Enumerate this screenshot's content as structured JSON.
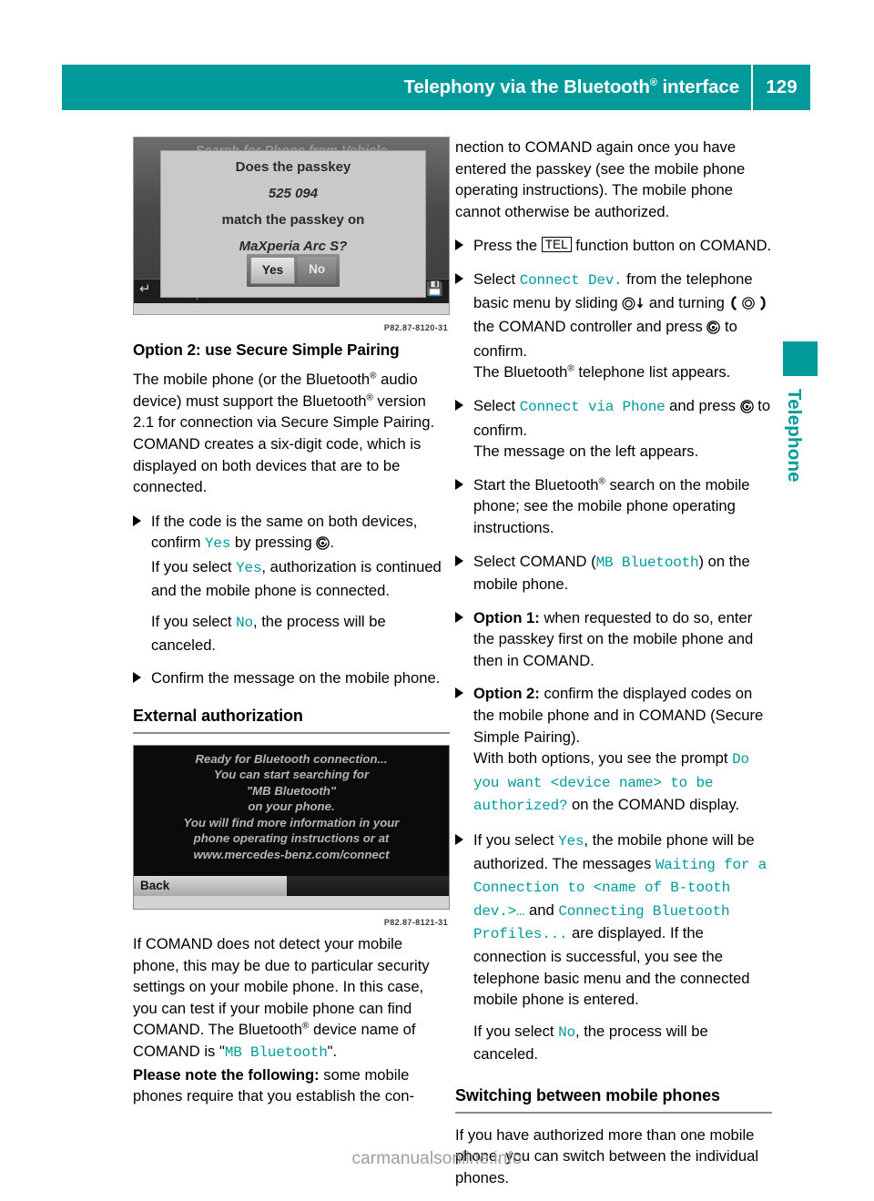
{
  "header": {
    "title_pre": "Telephony via the Bluetooth",
    "title_reg": "®",
    "title_post": " interface",
    "page_number": "129",
    "accent_color": "#009a9b"
  },
  "side_tab": {
    "label": "Telephone"
  },
  "watermark": "carmanualsonline.info",
  "left_column": {
    "figure1": {
      "screen_title_ghost": "Search for Phone from Vehicle",
      "dialog_line1": "Does the passkey",
      "dialog_code": "525 094",
      "dialog_line2": "match the passkey on",
      "dialog_device": "MaXperia Arc S?",
      "button_yes": "Yes",
      "button_no": "No",
      "list_entry": "MaXperia Arc S",
      "caption": "P82.87-8120-31"
    },
    "heading_option2": "Option 2: use Secure Simple Pairing",
    "para_option2_a": "The mobile phone (or the Bluetooth",
    "para_option2_b": " audio device) must support the Bluetooth",
    "para_option2_c": " version 2.1 for connection via Secure Simple Pairing. COMAND creates a six-digit code, which is displayed on both devices that are to be connected.",
    "bullet1_a": "If the code is the same on both devices, confirm ",
    "bullet1_yes": "Yes",
    "bullet1_b": " by pressing ",
    "bullet1_c": ".",
    "bullet1_line2_a": "If you select ",
    "bullet1_line2_yes": "Yes",
    "bullet1_line2_b": ", authorization is continued and the mobile phone is connected.",
    "bullet1_line3_a": "If you select ",
    "bullet1_line3_no": "No",
    "bullet1_line3_b": ", the process will be canceled.",
    "bullet2": "Confirm the message on the mobile phone.",
    "heading_external": "External authorization",
    "figure2": {
      "line1": "Ready for Bluetooth connection...",
      "line2": "You can start searching for",
      "line3": "\"MB Bluetooth\"",
      "line4": "on your phone.",
      "line5": "You will find more information in your",
      "line6": "phone operating instructions or at",
      "line7": "www.mercedes-benz.com/connect",
      "back_button": "Back",
      "caption": "P82.87-8121-31"
    },
    "para_detect_a": "If COMAND does not detect your mobile phone, this may be due to particular security settings on your mobile phone. In this case, you can test if your mobile phone can find COMAND. The Bluetooth",
    "para_detect_b": " device name of COMAND is \"",
    "para_detect_mono": "MB Bluetooth",
    "para_detect_c": "\".",
    "para_note_bold": "Please note the following:",
    "para_note_rest": " some mobile phones require that you establish the con-"
  },
  "right_column": {
    "para_top": "nection to COMAND again once you have entered the passkey (see the mobile phone operating instructions). The mobile phone cannot otherwise be authorized.",
    "bullet_tel_a": "Press the ",
    "bullet_tel_key": "TEL",
    "bullet_tel_b": " function button on COMAND.",
    "bullet_connect_a": "Select ",
    "bullet_connect_mono": "Connect Dev.",
    "bullet_connect_b": " from the telephone basic menu by sliding ",
    "bullet_connect_c": " and turning ",
    "bullet_connect_d": " the COMAND controller and press ",
    "bullet_connect_e": " to confirm.",
    "bullet_connect_line2_a": "The Bluetooth",
    "bullet_connect_line2_b": " telephone list appears.",
    "bullet_via_a": "Select ",
    "bullet_via_mono": "Connect via Phone",
    "bullet_via_b": " and press ",
    "bullet_via_c": " to confirm.",
    "bullet_via_line2": "The message on the left appears.",
    "bullet_search_a": "Start the Bluetooth",
    "bullet_search_b": " search on the mobile phone; see the mobile phone operating instructions.",
    "bullet_select_a": "Select COMAND (",
    "bullet_select_mono": "MB Bluetooth",
    "bullet_select_b": ") on the mobile phone.",
    "bullet_opt1_bold": "Option 1:",
    "bullet_opt1_rest": " when requested to do so, enter the passkey first on the mobile phone and then in COMAND.",
    "bullet_opt2_bold": "Option 2:",
    "bullet_opt2_rest": " confirm the displayed codes on the mobile phone and in COMAND (Secure Simple Pairing).",
    "bullet_opt2_line2_a": "With both options, you see the prompt ",
    "bullet_opt2_line2_mono": "Do you want <device name> to be authorized?",
    "bullet_opt2_line2_b": " on the COMAND display.",
    "bullet_yes_a": "If you select ",
    "bullet_yes_mono": "Yes",
    "bullet_yes_b": ", the mobile phone will be authorized. The messages ",
    "bullet_yes_mono2": "Waiting for a Connection to <name of B-tooth dev.>…",
    "bullet_yes_c": " and ",
    "bullet_yes_mono3": "Connecting Bluetooth Profiles...",
    "bullet_yes_d": " are displayed. If the connection is successful, you see the telephone basic menu and the connected mobile phone is entered.",
    "bullet_yes_line2_a": "If you select ",
    "bullet_yes_line2_mono": "No",
    "bullet_yes_line2_b": ", the process will be canceled.",
    "heading_switching": "Switching between mobile phones",
    "para_switching": "If you have authorized more than one mobile phone, you can switch between the individual phones."
  }
}
